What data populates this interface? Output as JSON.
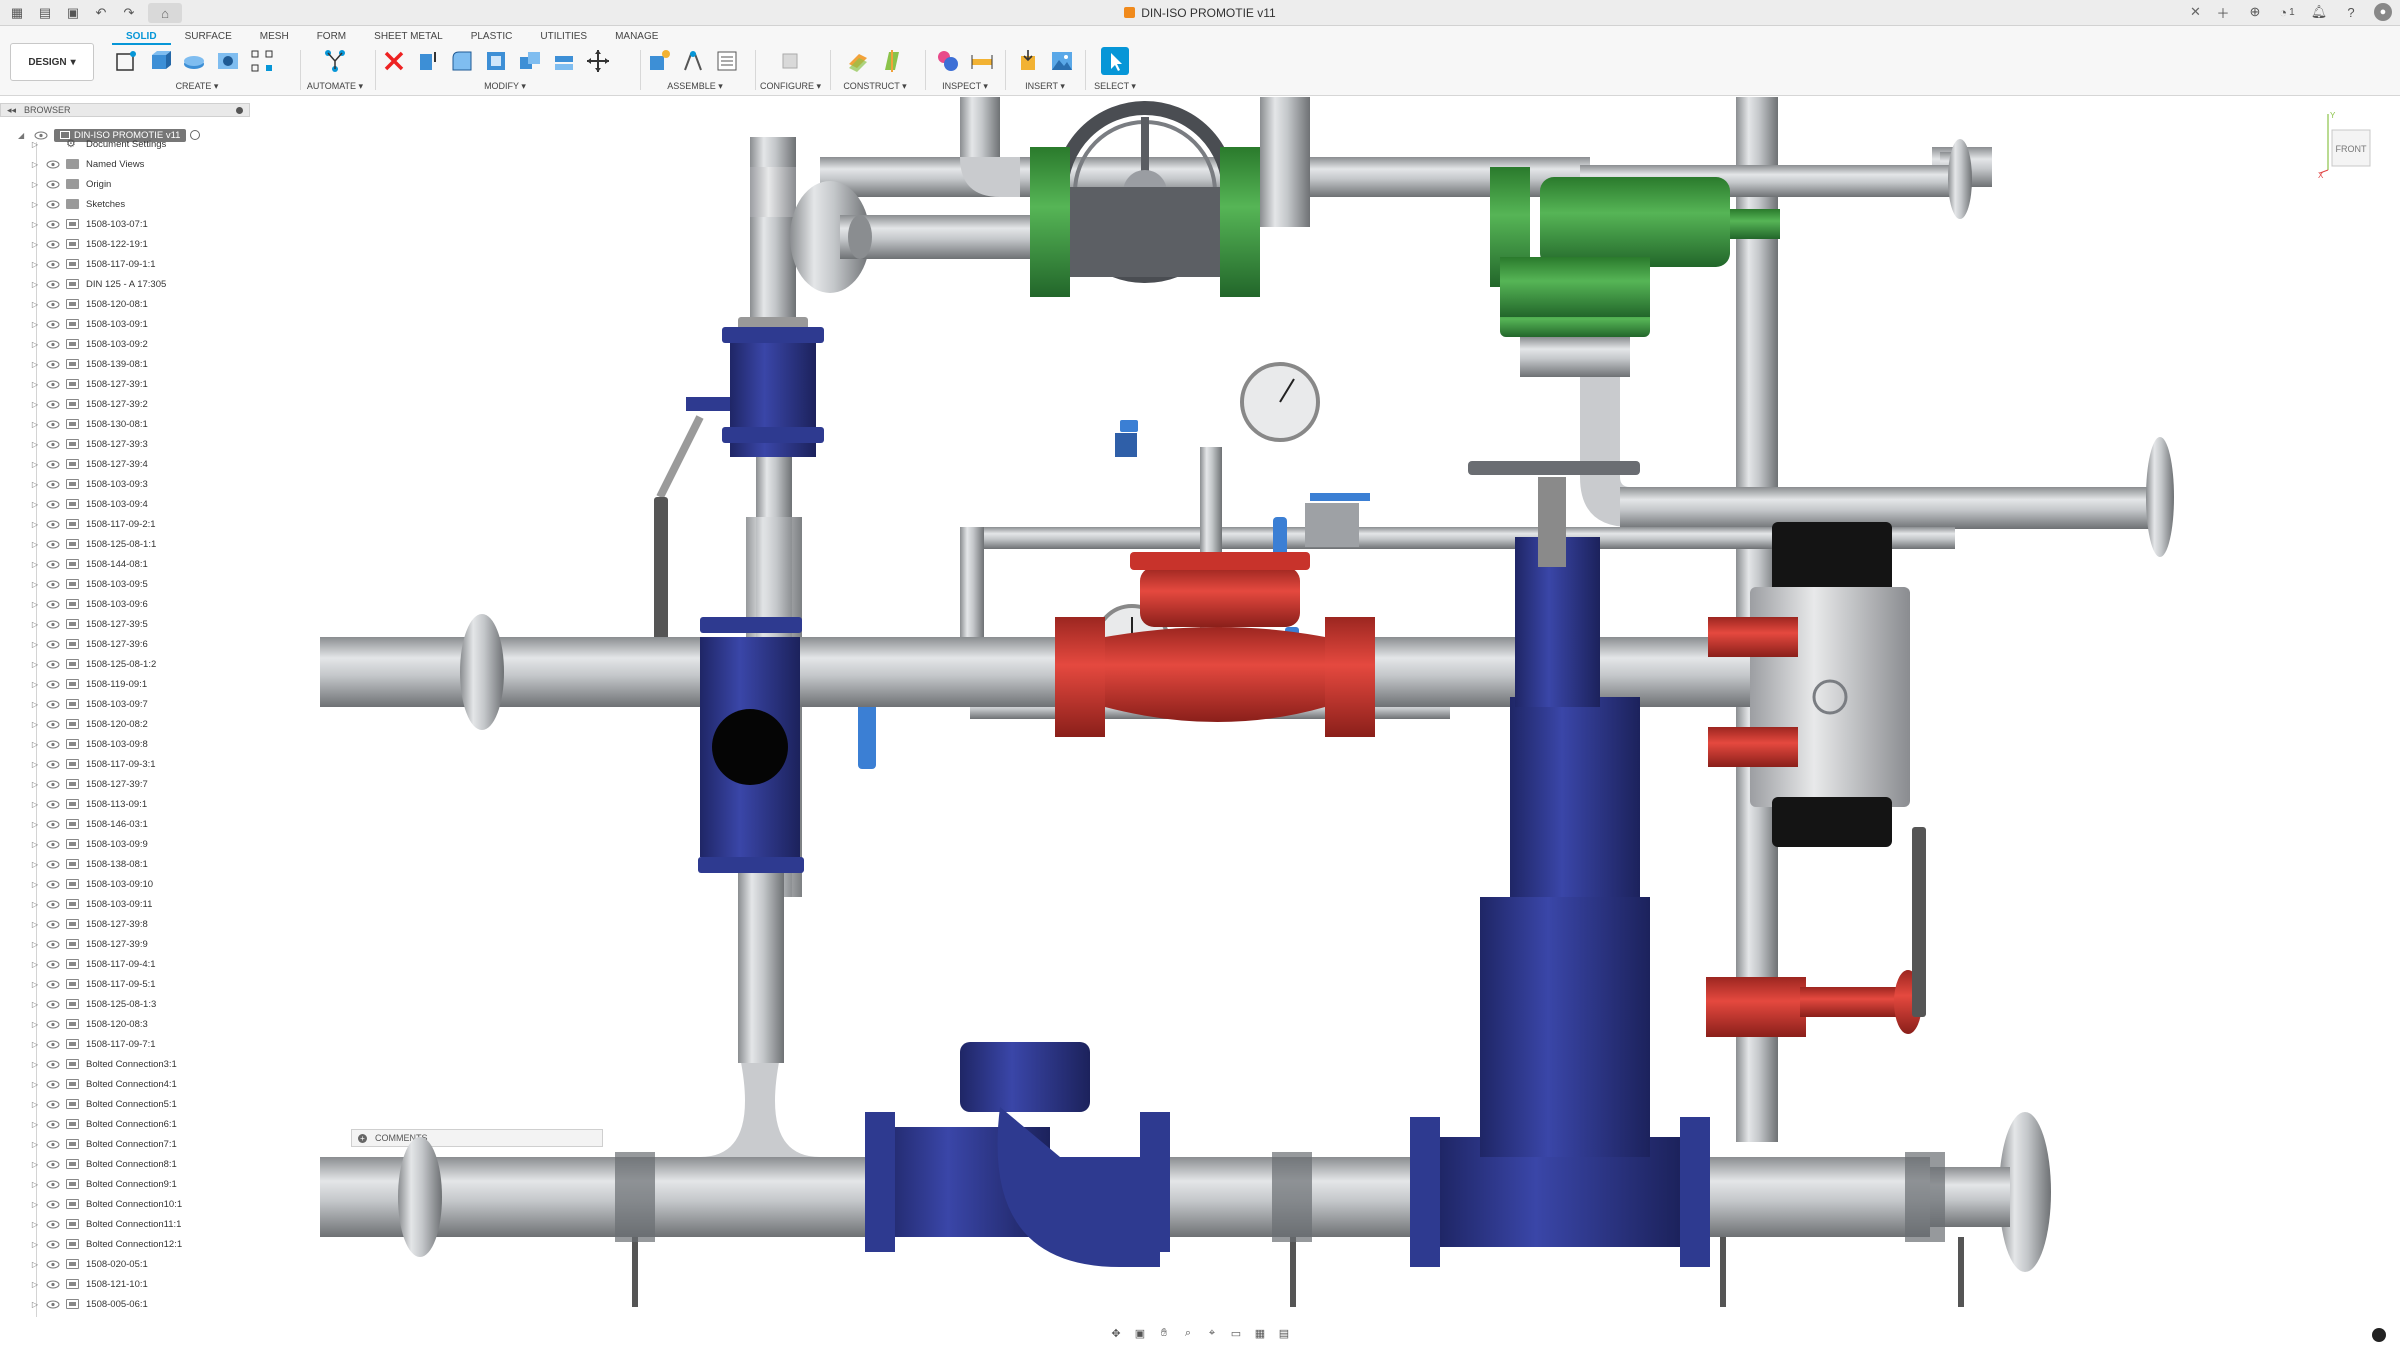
{
  "titlebar": {
    "document_title": "DIN-ISO PROMOTIE v11",
    "user_count": "1"
  },
  "toolbar": {
    "workspace": "DESIGN",
    "tabs": [
      "SOLID",
      "SURFACE",
      "MESH",
      "FORM",
      "SHEET METAL",
      "PLASTIC",
      "UTILITIES",
      "MANAGE"
    ],
    "groups": {
      "create": "CREATE ▾",
      "automate": "AUTOMATE ▾",
      "modify": "MODIFY ▾",
      "assemble": "ASSEMBLE ▾",
      "configure": "CONFIGURE ▾",
      "construct": "CONSTRUCT ▾",
      "inspect": "INSPECT ▾",
      "insert": "INSERT ▾",
      "select": "SELECT ▾"
    }
  },
  "browser": {
    "title": "BROWSER",
    "root": "DIN-ISO PROMOTIE v11",
    "items": [
      "Document Settings",
      "Named Views",
      "Origin",
      "Sketches",
      "1508-103-07:1",
      "1508-122-19:1",
      "1508-117-09-1:1",
      "DIN 125 - A 17:305",
      "1508-120-08:1",
      "1508-103-09:1",
      "1508-103-09:2",
      "1508-139-08:1",
      "1508-127-39:1",
      "1508-127-39:2",
      "1508-130-08:1",
      "1508-127-39:3",
      "1508-127-39:4",
      "1508-103-09:3",
      "1508-103-09:4",
      "1508-117-09-2:1",
      "1508-125-08-1:1",
      "1508-144-08:1",
      "1508-103-09:5",
      "1508-103-09:6",
      "1508-127-39:5",
      "1508-127-39:6",
      "1508-125-08-1:2",
      "1508-119-09:1",
      "1508-103-09:7",
      "1508-120-08:2",
      "1508-103-09:8",
      "1508-117-09-3:1",
      "1508-127-39:7",
      "1508-113-09:1",
      "1508-146-03:1",
      "1508-103-09:9",
      "1508-138-08:1",
      "1508-103-09:10",
      "1508-103-09:11",
      "1508-127-39:8",
      "1508-127-39:9",
      "1508-117-09-4:1",
      "1508-117-09-5:1",
      "1508-125-08-1:3",
      "1508-120-08:3",
      "1508-117-09-7:1",
      "Bolted Connection3:1",
      "Bolted Connection4:1",
      "Bolted Connection5:1",
      "Bolted Connection6:1",
      "Bolted Connection7:1",
      "Bolted Connection8:1",
      "Bolted Connection9:1",
      "Bolted Connection10:1",
      "Bolted Connection11:1",
      "Bolted Connection12:1",
      "1508-020-05:1",
      "1508-121-10:1",
      "1508-005-06:1"
    ]
  },
  "comments": {
    "label": "COMMENTS"
  },
  "viewcube": {
    "face": "FRONT",
    "axis_y": "Y",
    "axis_x": "X"
  },
  "colors": {
    "accent": "#0696d7",
    "steel": "#b9bcbf",
    "blue_valve": "#2b3585",
    "red_valve": "#cf3a33",
    "green_valve": "#3c9a3c"
  }
}
